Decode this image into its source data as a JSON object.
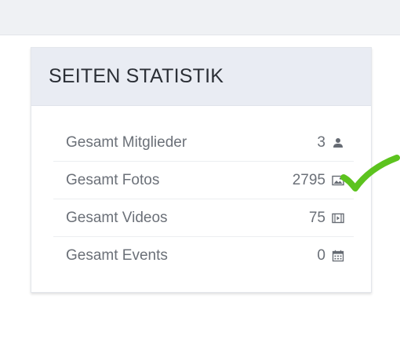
{
  "panel": {
    "title": "SEITEN STATISTIK"
  },
  "stats": [
    {
      "label": "Gesamt Mitglieder",
      "value": "3",
      "icon": "user-icon"
    },
    {
      "label": "Gesamt Fotos",
      "value": "2795",
      "icon": "image-icon"
    },
    {
      "label": "Gesamt Videos",
      "value": "75",
      "icon": "video-icon"
    },
    {
      "label": "Gesamt Events",
      "value": "0",
      "icon": "calendar-icon"
    }
  ],
  "colors": {
    "checkmark": "#5cc31e",
    "header_bg": "#e9ecf3",
    "text_muted": "#6b7078"
  }
}
